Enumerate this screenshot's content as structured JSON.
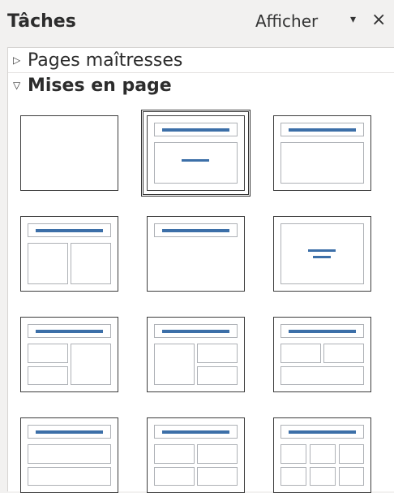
{
  "header": {
    "title": "Tâches",
    "view_label": "Afficher",
    "view_arrow": "▾",
    "close_label": "×"
  },
  "sections": {
    "master_pages": {
      "chevron": "▷",
      "label": "Pages maîtresses"
    },
    "layouts": {
      "chevron": "▽",
      "label": "Mises en page"
    }
  },
  "layouts": {
    "selected": "title-content",
    "items": [
      "blank",
      "title-content",
      "title-box",
      "title-two-columns",
      "title-only",
      "centered-text",
      "title-2-left-1-right",
      "title-1-left-2-right",
      "title-2-top-1-bottom",
      "title-2-rows",
      "title-2x2",
      "title-3x2"
    ]
  },
  "colors": {
    "accent": "#3c6fa8",
    "placeholder_border": "#aeb1b6",
    "tile_border": "#3d3d3d"
  }
}
